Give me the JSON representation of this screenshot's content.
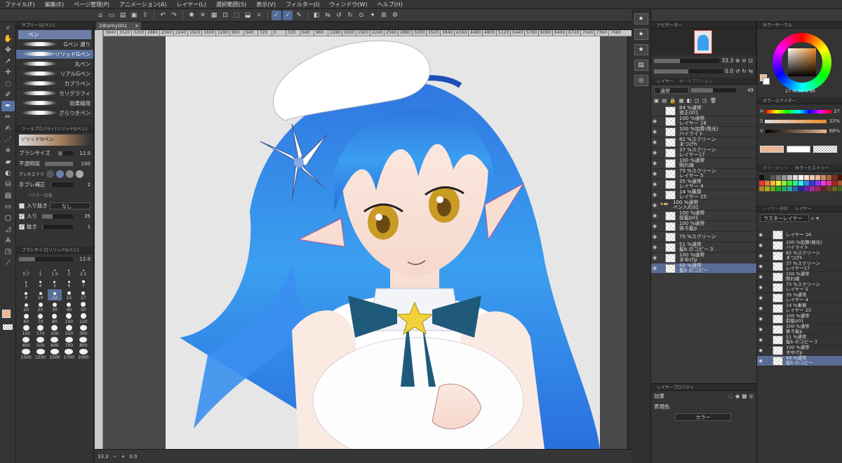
{
  "menu": [
    "ファイル(F)",
    "編集(E)",
    "ページ管理(P)",
    "アニメーション(A)",
    "レイヤー(L)",
    "選択範囲(S)",
    "表示(V)",
    "フィルター(I)",
    "ウィンドウ(W)",
    "ヘルプ(H)"
  ],
  "document_tab": "24tamy001",
  "subtool": {
    "header": "サブツール[ペン]",
    "group": "ペン",
    "brushes": [
      {
        "label": "Gペン 濃り",
        "active": false
      },
      {
        "label": "ソリッドGペン",
        "active": true
      },
      {
        "label": "丸ペン",
        "active": false
      },
      {
        "label": "リアルGペン",
        "active": false
      },
      {
        "label": "カブラペン",
        "active": false
      },
      {
        "label": "カリグラフィ",
        "active": false
      },
      {
        "label": "効果線用",
        "active": false
      },
      {
        "label": "ざらつきペン",
        "active": false
      }
    ]
  },
  "tool_property": {
    "header": "ツールプロパティ[ソリッドGペン]",
    "name": "ソリッドGペン",
    "brush_size_label": "ブラシサイズ",
    "brush_size_value": "12.0",
    "opacity_label": "不透明度",
    "opacity_value": "100",
    "antialias_label": "アンチエイリ",
    "stabilization_label": "手ブレ補正",
    "stabilization_value": "2",
    "vector_label": "ベクター吸着",
    "taper_label": "入り抜き",
    "taper_value": "なし",
    "in_label": "入り",
    "in_value": "35",
    "out_label": "抜き",
    "out_value": "1"
  },
  "brush_size_panel": {
    "header": "ブラシサイズ[ソリッドGペン]",
    "current": "12.0",
    "sizes": [
      "0.7",
      "1",
      "1.5",
      "2",
      "2.5",
      "3",
      "4",
      "5",
      "6",
      "7",
      "8",
      "10",
      "12",
      "15",
      "17",
      "20",
      "25",
      "30",
      "40",
      "50",
      "60",
      "70",
      "80",
      "100",
      "120",
      "150",
      "170",
      "200",
      "250",
      "300",
      "400",
      "500",
      "600",
      "700",
      "800",
      "1000",
      "1200",
      "1500",
      "1700",
      "2000"
    ],
    "active": "12"
  },
  "ruler_marks": [
    "3840",
    "3520",
    "3200",
    "2880",
    "2560",
    "2240",
    "1920",
    "1600",
    "1280",
    "960",
    "640",
    "320",
    "0",
    "320",
    "640",
    "960",
    "1280",
    "1600",
    "1920",
    "2240",
    "2560",
    "2880",
    "3200",
    "3520",
    "3840",
    "4160",
    "4480",
    "4800",
    "5120",
    "5440",
    "5760",
    "6080",
    "6400",
    "6720",
    "7040",
    "7360",
    "7680"
  ],
  "canvas_footer": {
    "zoom": "33.3",
    "angle": "0.0"
  },
  "navigator": {
    "header": "ナビゲーター",
    "zoom": "33.3",
    "rotate": "0.0"
  },
  "layer_panel": {
    "header": "レイヤー",
    "header2": "オートアクション",
    "blend_mode": "通常",
    "opacity": "49",
    "layers": [
      {
        "line1": "84 %通常",
        "line2": "修正001",
        "selected": false,
        "folder": false,
        "eye": false
      },
      {
        "line1": "100 %通常",
        "line2": "レイヤー 16",
        "selected": false,
        "folder": false,
        "eye": true
      },
      {
        "line1": "100 %加算(発光)",
        "line2": "ハイライト",
        "selected": false,
        "folder": false,
        "eye": true
      },
      {
        "line1": "82 %スクリーン",
        "line2": "まつげh",
        "selected": false,
        "folder": false,
        "eye": true
      },
      {
        "line1": "37 %スクリーン",
        "line2": "レイヤー17",
        "selected": false,
        "folder": false,
        "eye": true
      },
      {
        "line1": "100 %通常",
        "line2": "照れ線",
        "selected": false,
        "folder": false,
        "eye": true
      },
      {
        "line1": "75 %スクリーン",
        "line2": "レイヤー 5",
        "selected": false,
        "folder": false,
        "eye": true
      },
      {
        "line1": "35 %通常",
        "line2": "レイヤー 4",
        "selected": false,
        "folder": false,
        "eye": true
      },
      {
        "line1": "14 %乗算",
        "line2": "レイヤー 25",
        "selected": false,
        "folder": false,
        "eye": true
      },
      {
        "line1": "100 %通常",
        "line2": "ペン入れ01",
        "selected": false,
        "folder": true,
        "eye": true
      },
      {
        "line1": "100 %通常",
        "line2": "前髪p01",
        "selected": false,
        "folder": false,
        "eye": true
      },
      {
        "line1": "100 %通常",
        "line2": "後ろ髪p",
        "selected": false,
        "folder": false,
        "eye": true
      },
      {
        "line1": "75 %スクリーン",
        "line2": "",
        "selected": false,
        "folder": false,
        "eye": true
      },
      {
        "line1": "51 %通常",
        "line2": "髪b のコピー 3",
        "selected": false,
        "folder": false,
        "eye": true
      },
      {
        "line1": "100 %通常",
        "line2": "まゆげp",
        "selected": false,
        "folder": false,
        "eye": true
      },
      {
        "line1": "49 %通常",
        "line2": "髪b のコピー",
        "selected": true,
        "folder": false,
        "eye": true
      }
    ]
  },
  "layer_property": {
    "header": "レイヤープロパティ",
    "effect_label": "効果",
    "color_label": "表現色",
    "color_value": "カラー"
  },
  "color_circle": {
    "header": "カラーサークル",
    "h": "27",
    "s": "33",
    "v": "88",
    "main_color": "#e8b896",
    "sub_color": "#ffffff"
  },
  "color_slider": {
    "header": "カラースライダー",
    "h_label": "H",
    "h_value": "27",
    "s_label": "S",
    "s_value": "33%",
    "v_label": "V",
    "v_value": "88%"
  },
  "color_set": {
    "header": "カラーセット",
    "header2": "カラーヒストリー"
  },
  "layer_panel2": {
    "header": "レイヤー",
    "header2": "レイヤー検索",
    "mode": "ラスターレイヤー",
    "layers": [
      {
        "line1": "",
        "line2": "レイヤー 16",
        "selected": false
      },
      {
        "line1": "100 %加算(発光)",
        "line2": "ハイライト",
        "selected": false
      },
      {
        "line1": "82 %スクリーン",
        "line2": "まつげh",
        "selected": false
      },
      {
        "line1": "37 %スクリーン",
        "line2": "レイヤー17",
        "selected": false
      },
      {
        "line1": "100 %通常",
        "line2": "照れ線",
        "selected": false
      },
      {
        "line1": "75 %スクリーン",
        "line2": "レイヤー 5",
        "selected": false
      },
      {
        "line1": "35 %通常",
        "line2": "レイヤー 4",
        "selected": false
      },
      {
        "line1": "14 %乗算",
        "line2": "レイヤー 25",
        "selected": false
      },
      {
        "line1": "100 %通常",
        "line2": "前髪p01",
        "selected": false
      },
      {
        "line1": "100 %通常",
        "line2": "後ろ髪p",
        "selected": false
      },
      {
        "line1": "51 %通常",
        "line2": "髪b のコピー 3",
        "selected": false
      },
      {
        "line1": "100 %通常",
        "line2": "まゆげp",
        "selected": false
      },
      {
        "line1": "49 %通常",
        "line2": "髪b のコピー",
        "selected": true
      }
    ]
  }
}
